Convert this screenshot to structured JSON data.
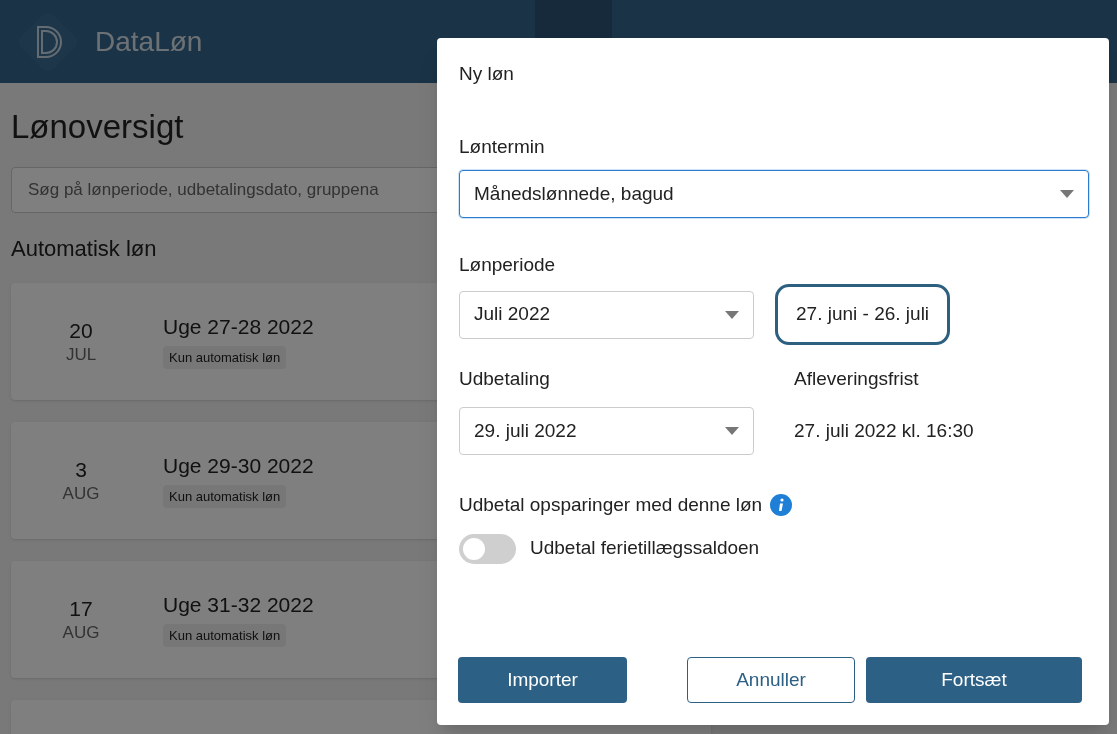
{
  "app": {
    "logo_text": "DataLøn"
  },
  "page": {
    "title": "Lønoversigt",
    "search": {
      "placeholder": "Søg på lønperiode, udbetalingsdato, gruppena"
    },
    "section_title": "Automatisk løn",
    "cards": [
      {
        "day": "20",
        "month": "JUL",
        "title": "Uge 27-28 2022",
        "tag": "Kun automatisk løn"
      },
      {
        "day": "3",
        "month": "AUG",
        "title": "Uge 29-30 2022",
        "tag": "Kun automatisk løn"
      },
      {
        "day": "17",
        "month": "AUG",
        "title": "Uge 31-32 2022",
        "tag": "Kun automatisk løn"
      }
    ]
  },
  "dialog": {
    "title": "Ny løn",
    "term": {
      "label": "Løntermin",
      "value": "Månedslønnede, bagud",
      "focused": true
    },
    "period": {
      "label": "Lønperiode",
      "value": "Juli 2022",
      "range": "27. juni - 26. juli"
    },
    "payout": {
      "label": "Udbetaling",
      "value": "29. juli 2022"
    },
    "deadline": {
      "label": "Afleveringsfrist",
      "value": "27. juli 2022 kl. 16:30"
    },
    "savings": {
      "label": "Udbetal opsparinger med denne løn",
      "toggle_label": "Udbetal ferietillægssaldoen",
      "on": false
    },
    "buttons": [
      {
        "label": "Importer",
        "kind": "primary"
      },
      {
        "label": "Annuller",
        "kind": "secondary"
      },
      {
        "label": "Fortsæt",
        "kind": "primary"
      }
    ]
  }
}
